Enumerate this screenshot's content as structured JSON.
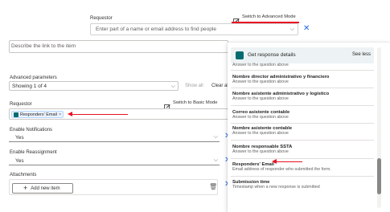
{
  "top": {
    "requestor_label": "Requestor",
    "switch_advanced": "Switch to Advanced Mode",
    "requestor_placeholder": "Enter part of a name or email address to find people"
  },
  "form": {
    "describe_placeholder": "Describe the link to the item",
    "advanced_parameters_label": "Advanced parameters",
    "showing_value": "Showing 1 of 4",
    "show_all": "Show all",
    "clear_all": "Clear all",
    "requestor_label": "Requestor",
    "switch_basic": "Switch to Basic Mode",
    "token_label": "Responders' Email",
    "enable_notifications_label": "Enable Notifications",
    "enable_notifications_value": "Yes",
    "enable_reassignment_label": "Enable Reassignment",
    "enable_reassignment_value": "Yes",
    "attachments_label": "Attachments",
    "add_new_item": "Add new item"
  },
  "dropdown": {
    "header_title": "Get response details",
    "see_less": "See less",
    "items": [
      {
        "title": "",
        "desc": "Answer to the question above"
      },
      {
        "title": "Nombre director administrativo y financiero",
        "desc": "Answer to the question above"
      },
      {
        "title": "Nombre asistente administrativo y logístico",
        "desc": "Answer to the question above"
      },
      {
        "title": "Correo asistente contable",
        "desc": "Answer to the question above"
      },
      {
        "title": "Nombre asistente contable",
        "desc": "Answer to the question above"
      },
      {
        "title": "Nombre responsable SSTA",
        "desc": "Answer to the question above"
      },
      {
        "title": "Responders' Email",
        "desc": "Email address of responder who submitted the form."
      },
      {
        "title": "Submission time",
        "desc": "Timestamp when a new response is submitted"
      }
    ]
  },
  "colors": {
    "accent": "#2266e3",
    "annotation_red": "#e81123",
    "forms_icon_green": "#036c70"
  }
}
